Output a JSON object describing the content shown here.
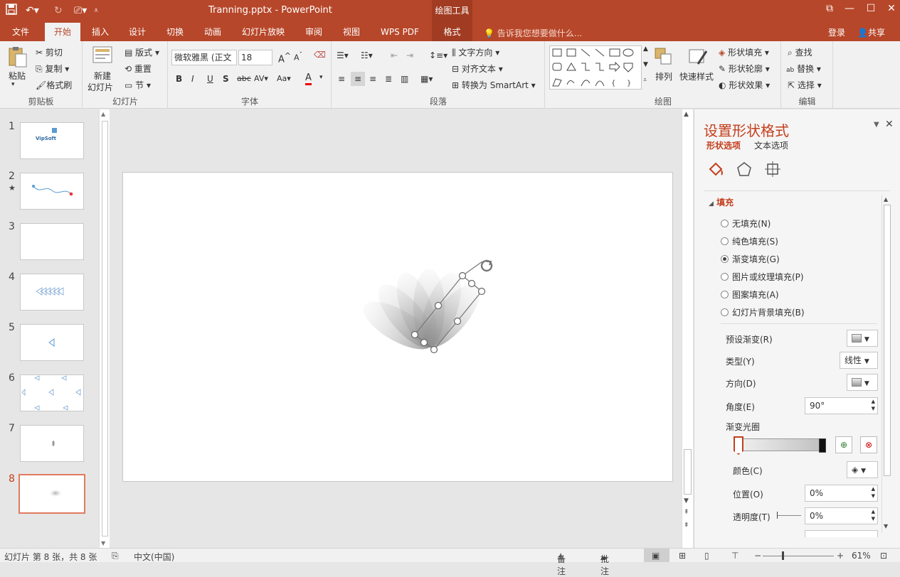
{
  "app": {
    "title": "Tranning.pptx - PowerPoint",
    "context_tab_group": "绘图工具",
    "accent": "#b7472a"
  },
  "tabs": [
    {
      "label": "文件"
    },
    {
      "label": "开始"
    },
    {
      "label": "插入"
    },
    {
      "label": "设计"
    },
    {
      "label": "切换"
    },
    {
      "label": "动画"
    },
    {
      "label": "幻灯片放映"
    },
    {
      "label": "审阅"
    },
    {
      "label": "视图"
    },
    {
      "label": "WPS PDF"
    },
    {
      "label": "格式"
    }
  ],
  "tell_me": "告诉我您想要做什么...",
  "account": {
    "login": "登录",
    "share": "共享"
  },
  "ribbon": {
    "clipboard": {
      "paste": "粘贴",
      "cut": "剪切",
      "copy": "复制",
      "format_painter": "格式刷",
      "label": "剪贴板"
    },
    "slides": {
      "new_slide": "新建",
      "new_slide2": "幻灯片",
      "layout": "版式",
      "reset": "重置",
      "section": "节",
      "label": "幻灯片"
    },
    "font": {
      "family": "微软雅黑 (正文",
      "size": "18",
      "label": "字体"
    },
    "paragraph": {
      "text_direction": "文字方向",
      "align_text": "对齐文本",
      "convert_smartart": "转换为 SmartArt",
      "label": "段落"
    },
    "drawing": {
      "arrange": "排列",
      "quick_styles": "快速样式",
      "shape_fill": "形状填充",
      "shape_outline": "形状轮廓",
      "shape_effects": "形状效果",
      "label": "绘图"
    },
    "editing": {
      "find": "查找",
      "replace": "替换",
      "select": "选择",
      "label": "编辑"
    }
  },
  "slides": [
    {
      "num": "1",
      "text": "VipSoft"
    },
    {
      "num": "2",
      "star": "★"
    },
    {
      "num": "3"
    },
    {
      "num": "4"
    },
    {
      "num": "5"
    },
    {
      "num": "6"
    },
    {
      "num": "7"
    },
    {
      "num": "8"
    }
  ],
  "format_pane": {
    "title": "设置形状格式",
    "tab_shape": "形状选项",
    "tab_text": "文本选项",
    "section_fill": "填充",
    "fill_options": [
      "无填充(N)",
      "纯色填充(S)",
      "渐变填充(G)",
      "图片或纹理填充(P)",
      "图案填充(A)",
      "幻灯片背景填充(B)"
    ],
    "selected_fill": 2,
    "preset_gradient": "预设渐变(R)",
    "type_label": "类型(Y)",
    "type_value": "线性",
    "direction_label": "方向(D)",
    "angle_label": "角度(E)",
    "angle_value": "90°",
    "stops_label": "渐变光圈",
    "color_label": "颜色(C)",
    "position_label": "位置(O)",
    "position_value": "0%",
    "transparency_label": "透明度(T)",
    "transparency_value": "0%"
  },
  "status": {
    "slide_info": "幻灯片 第 8 张，共 8 张",
    "language": "中文(中国)",
    "notes": "备注",
    "comments": "批注",
    "zoom": "61%"
  }
}
